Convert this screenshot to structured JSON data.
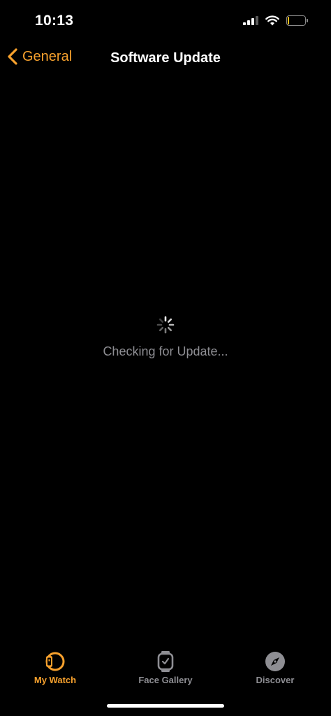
{
  "status_bar": {
    "time": "10:13",
    "battery_level": "9",
    "battery_fraction": 0.09
  },
  "nav": {
    "back_label": "General",
    "title": "Software Update"
  },
  "content": {
    "loading_text": "Checking for Update..."
  },
  "tabs": [
    {
      "label": "My Watch",
      "icon": "my-watch-icon",
      "active": true
    },
    {
      "label": "Face Gallery",
      "icon": "face-gallery-icon",
      "active": false
    },
    {
      "label": "Discover",
      "icon": "compass-icon",
      "active": false
    }
  ],
  "colors": {
    "accent": "#f7a12d",
    "inactive": "#8e8e93",
    "background": "#000000",
    "battery_low": "#f2c01e"
  }
}
